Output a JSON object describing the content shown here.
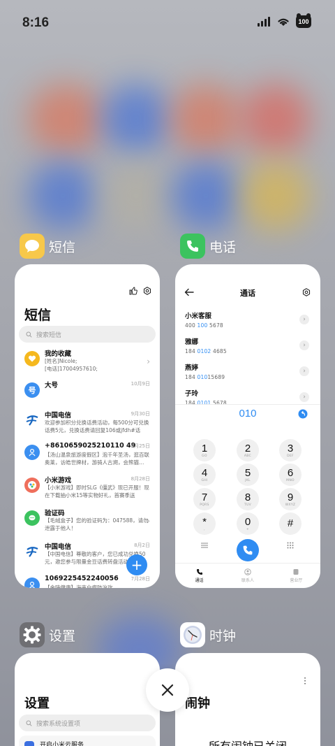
{
  "status_bar": {
    "time": "8:16",
    "battery": "100"
  },
  "cards": {
    "sms": {
      "app_name": "短信",
      "title": "短信",
      "search_placeholder": "搜索短信",
      "messages": [
        {
          "name": "我的收藏",
          "date": "",
          "preview": "[姓名]Nicole;\n[电话]17004957610;",
          "avatar_color": "#f5b81e",
          "avatar_icon": "heart-icon"
        },
        {
          "name": "大号",
          "date": "10月9日",
          "preview": "",
          "avatar_color": "#3b8ff0",
          "avatar_icon": "hao-icon"
        },
        {
          "name": "中国电信",
          "date": "9月30日",
          "preview": "欢迎参加积分兑换话费活动，每500分可兑换话费5元，兑换话费请回复106或jfdh#话费…",
          "avatar_color": "#ffffff",
          "avatar_icon": "china-telecom-icon"
        },
        {
          "name": "+8610659025210110 49",
          "date": "9月25日",
          "preview": "【汤山温泉旅游度假区】泡千年圣汤，逛百联奥莱，访皓世牌材，游骑人古溯，会熊猫…",
          "avatar_color": "#3b8ff0",
          "avatar_icon": "person-icon"
        },
        {
          "name": "小米游戏",
          "date": "8月28日",
          "preview": "【小米游戏】即时SLG《僵武》现已开服！现在下载抽小米15等实物好礼，首赛季送158…",
          "avatar_color": "#ef6f5c",
          "avatar_icon": "game-icon"
        },
        {
          "name": "验证码",
          "date": "",
          "preview": "【毛绒盒子】您的验证码为：047588，请勿泄露于他人！",
          "avatar_color": "#3cc35f",
          "avatar_icon": "chat-icon"
        },
        {
          "name": "中国电信",
          "date": "8月2日",
          "preview": "【中国电信】尊敬的客户，您已成功兑换50元，邀您参与限量金豆话费转盘活动…",
          "avatar_color": "#ffffff",
          "avatar_icon": "china-telecom-icon"
        },
        {
          "name": "1069225452240056",
          "date": "7月28日",
          "preview": "【金陵健康】海南白瘤防治攻",
          "avatar_color": "#3b8ff0",
          "avatar_icon": "person-icon"
        }
      ]
    },
    "phone": {
      "app_name": "电话",
      "title": "通话",
      "contacts": [
        {
          "name": "小米客服",
          "pre": "400 ",
          "hl": "100",
          "post": " 5678"
        },
        {
          "name": "雅娜",
          "pre": "184 ",
          "hl": "0102",
          "post": " 4685"
        },
        {
          "name": "燕婷",
          "pre": "184 ",
          "hl": "010",
          "post": "15689"
        },
        {
          "name": "子玲",
          "pre": "184 ",
          "hl": "0101",
          "post": " 5678"
        }
      ],
      "dialed": "010",
      "keys": [
        {
          "d": "1",
          "l": "GO"
        },
        {
          "d": "2",
          "l": "ABC"
        },
        {
          "d": "3",
          "l": "DEF"
        },
        {
          "d": "4",
          "l": "GHI"
        },
        {
          "d": "5",
          "l": "JKL"
        },
        {
          "d": "6",
          "l": "MNO"
        },
        {
          "d": "7",
          "l": "PQRS"
        },
        {
          "d": "8",
          "l": "TUV"
        },
        {
          "d": "9",
          "l": "WXYZ"
        },
        {
          "d": "*",
          "l": ","
        },
        {
          "d": "0",
          "l": "+"
        },
        {
          "d": "#",
          "l": ""
        }
      ],
      "tabs": [
        "通话",
        "联系人",
        "营业厅"
      ]
    },
    "settings": {
      "app_name": "设置",
      "title": "设置",
      "search_placeholder": "搜索系统设置项",
      "first_item": "开启小米云服务"
    },
    "clock": {
      "app_name": "时钟",
      "title": "闹钟",
      "empty_text": "所有闹钟已关闭"
    }
  },
  "colors": {
    "accent": "#2f8cf2",
    "phone_green": "#3cc35f",
    "sms_yellow": "#f7c84a"
  }
}
